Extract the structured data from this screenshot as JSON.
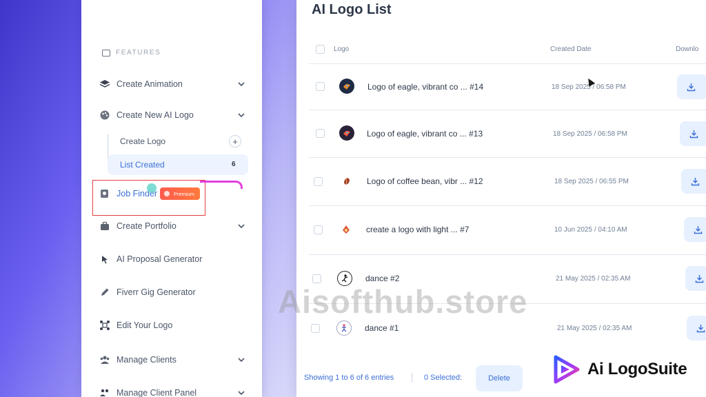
{
  "sidebar": {
    "section_heading": "FEATURES",
    "items": [
      {
        "label": "Create Animation",
        "icon": "layers-icon"
      },
      {
        "label": "Create New AI Logo",
        "icon": "palette-icon"
      },
      {
        "label": "Job Finder",
        "icon": "search-doc-icon",
        "badge": "Premium"
      },
      {
        "label": "Create Portfolio",
        "icon": "briefcase-icon"
      },
      {
        "label": "AI Proposal Generator",
        "icon": "cursor-sparkle-icon"
      },
      {
        "label": "Fiverr Gig Generator",
        "icon": "pen-icon"
      },
      {
        "label": "Edit Your Logo",
        "icon": "nodes-icon"
      },
      {
        "label": "Manage Clients",
        "icon": "users-icon"
      },
      {
        "label": "Manage Client Panel",
        "icon": "client-panel-icon"
      }
    ],
    "subitems": [
      {
        "label": "Create Logo"
      },
      {
        "label": "List Created",
        "count": "6"
      }
    ]
  },
  "main": {
    "title": "AI Logo List",
    "columns": {
      "logo": "Logo",
      "date": "Created Date",
      "download": "Downlo"
    },
    "rows": [
      {
        "name": "Logo of eagle, vibrant co ... #14",
        "date": "18 Sep 2025 / 06:58 PM",
        "thumb": "eagle-logo-thumb"
      },
      {
        "name": "Logo of eagle, vibrant co ... #13",
        "date": "18 Sep 2025 / 06:58 PM",
        "thumb": "eagle-logo-thumb"
      },
      {
        "name": "Logo of coffee bean, vibr ... #12",
        "date": "18 Sep 2025 / 06:55 PM",
        "thumb": "coffee-bean-thumb"
      },
      {
        "name": "create a logo with light ... #7",
        "date": "10 Jun 2025 / 04:10 AM",
        "thumb": "light-logo-thumb"
      },
      {
        "name": "dance #2",
        "date": "21 May 2025 / 02:35 AM",
        "thumb": "dance-thumb"
      },
      {
        "name": "dance #1",
        "date": "21 May 2025 / 02:35 AM",
        "thumb": "dance-thumb"
      }
    ],
    "footer": {
      "showing": "Showing 1 to 6 of 6 entries",
      "selected": "0 Selected:",
      "delete_label": "Delete"
    }
  },
  "overlay": {
    "watermark": "Aisofthub.store",
    "brand": "Ai LogoSuite"
  },
  "colors": {
    "accent": "#3b6fd6",
    "premium": "#ff5a4e",
    "highlight": "#e53e3e"
  }
}
